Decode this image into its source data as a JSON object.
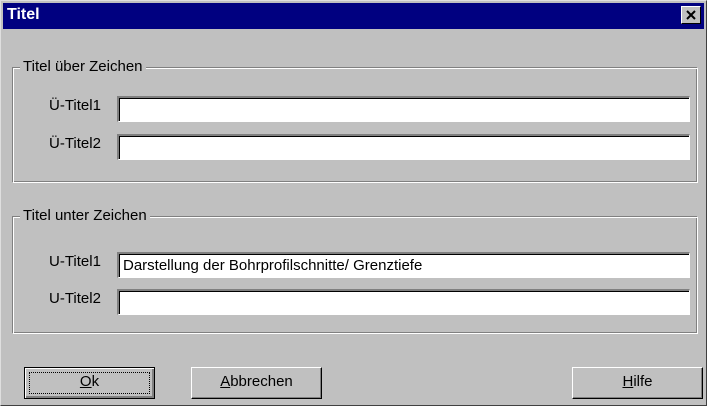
{
  "window": {
    "title": "Titel"
  },
  "groups": {
    "above": {
      "legend": "Titel über Zeichen",
      "fields": [
        {
          "label": "Ü-Titel1",
          "value": ""
        },
        {
          "label": "Ü-Titel2",
          "value": ""
        }
      ]
    },
    "below": {
      "legend": "Titel unter Zeichen",
      "fields": [
        {
          "label": "U-Titel1",
          "value": "Darstellung der Bohrprofilschnitte/ Grenztiefe"
        },
        {
          "label": "U-Titel2",
          "value": ""
        }
      ]
    }
  },
  "buttons": {
    "ok": {
      "mnemonic": "O",
      "rest": "k"
    },
    "cancel": {
      "mnemonic": "A",
      "rest": "bbrechen"
    },
    "help": {
      "mnemonic": "H",
      "rest": "ilfe"
    }
  },
  "colors": {
    "titlebar": "#000080",
    "face": "#c0c0c0"
  }
}
